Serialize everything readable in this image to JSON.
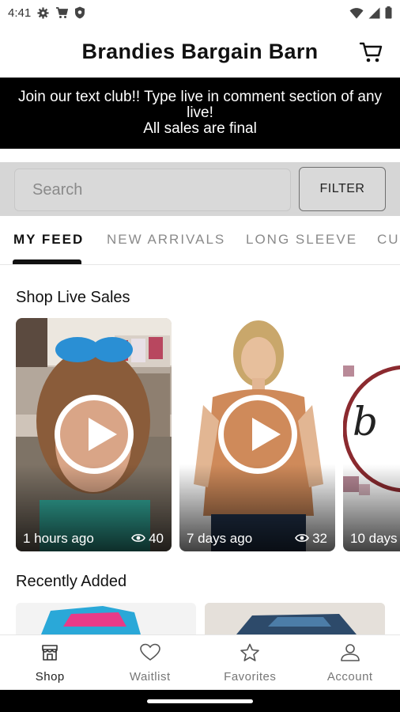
{
  "status_bar": {
    "time": "4:41",
    "icons": [
      "gear-icon",
      "cart-small-icon",
      "shield-icon",
      "wifi-icon",
      "signal-icon",
      "battery-icon"
    ]
  },
  "header": {
    "title": "Brandies Bargain Barn",
    "cart_icon": "cart-icon"
  },
  "banner": {
    "line1": "Join our text club!! Type live in comment section of any live!",
    "line2": "All sales are final"
  },
  "search": {
    "placeholder": "Search",
    "filter_label": "FILTER"
  },
  "tabs": [
    {
      "label": "MY FEED",
      "active": true
    },
    {
      "label": "NEW ARRIVALS",
      "active": false
    },
    {
      "label": "LONG SLEEVE",
      "active": false
    },
    {
      "label": "CU",
      "active": false
    }
  ],
  "live_sales": {
    "title": "Shop Live Sales",
    "cards": [
      {
        "time": "1 hours ago",
        "views": "40"
      },
      {
        "time": "7 days ago",
        "views": "32"
      },
      {
        "time": "10 days",
        "views": ""
      }
    ]
  },
  "recently_added": {
    "title": "Recently Added"
  },
  "bottom_nav": [
    {
      "label": "Shop",
      "icon": "shop-icon",
      "active": true
    },
    {
      "label": "Waitlist",
      "icon": "heart-icon",
      "active": false
    },
    {
      "label": "Favorites",
      "icon": "star-icon",
      "active": false
    },
    {
      "label": "Account",
      "icon": "account-icon",
      "active": false
    }
  ],
  "colors": {
    "banner_bg": "#000000",
    "search_strip_bg": "#d6d6d6",
    "text_primary": "#111111",
    "tab_inactive": "#8a8a8a"
  }
}
